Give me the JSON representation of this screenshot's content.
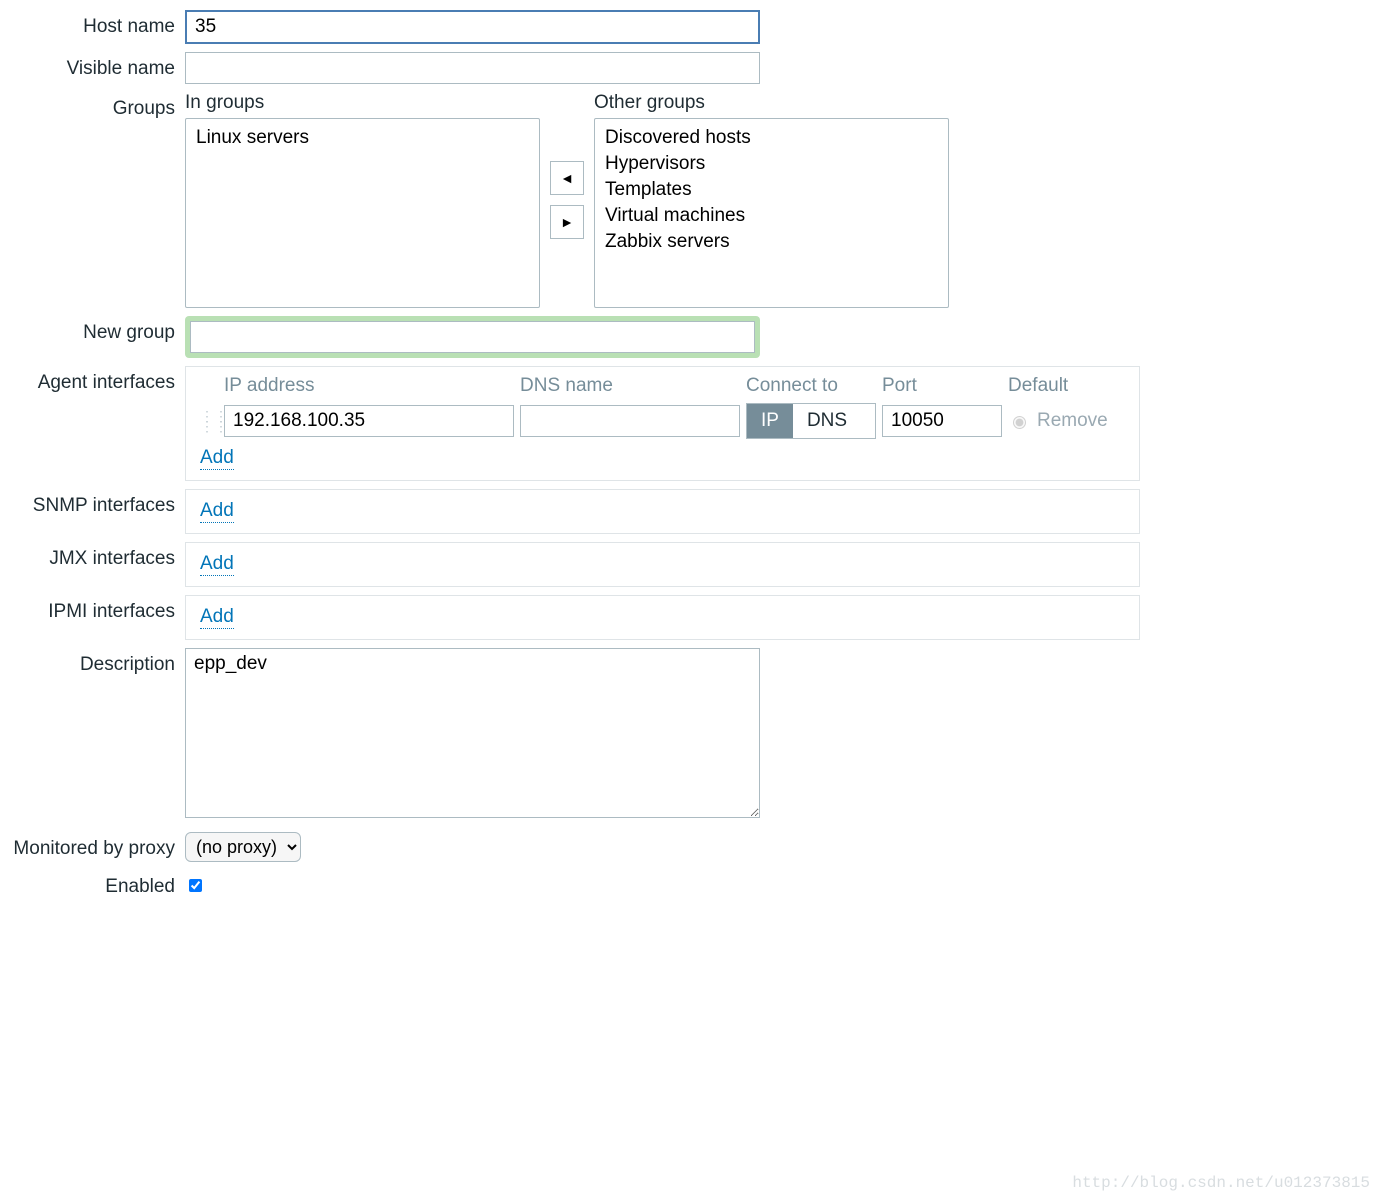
{
  "labels": {
    "host_name": "Host name",
    "visible_name": "Visible name",
    "groups": "Groups",
    "in_groups": "In groups",
    "other_groups": "Other groups",
    "new_group": "New group",
    "agent_ifaces": "Agent interfaces",
    "snmp_ifaces": "SNMP interfaces",
    "jmx_ifaces": "JMX interfaces",
    "ipmi_ifaces": "IPMI interfaces",
    "description": "Description",
    "monitored_by_proxy": "Monitored by proxy",
    "enabled": "Enabled",
    "ip_address": "IP address",
    "dns_name": "DNS name",
    "connect_to": "Connect to",
    "port": "Port",
    "default": "Default",
    "remove": "Remove",
    "add": "Add",
    "ip": "IP",
    "dns": "DNS"
  },
  "values": {
    "host_name": "35",
    "visible_name": "",
    "new_group": "",
    "description": "epp_dev",
    "proxy": "(no proxy)",
    "enabled": true
  },
  "groups": {
    "in": [
      "Linux servers"
    ],
    "other": [
      "Discovered hosts",
      "Hypervisors",
      "Templates",
      "Virtual machines",
      "Zabbix servers"
    ]
  },
  "agent_interface": {
    "ip": "192.168.100.35",
    "dns": "",
    "connect_to": "IP",
    "port": "10050",
    "default": true
  },
  "watermark": "http://blog.csdn.net/u012373815"
}
